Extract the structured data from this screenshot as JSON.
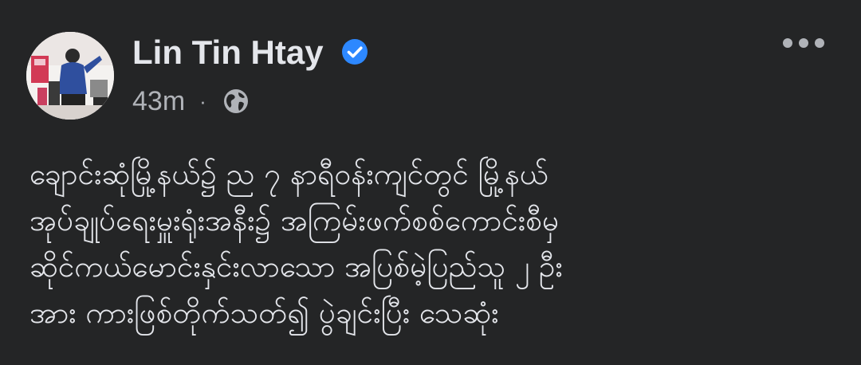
{
  "post": {
    "author": "Lin Tin Htay",
    "verified": true,
    "timestamp": "43m",
    "separator": "·",
    "privacy_icon": "globe-icon",
    "more_icon": "more-horizontal-icon",
    "text_lines": [
      "ချောင်းဆုံမြို့နယ်၌ ည ၇ နာရီဝန်းကျင်တွင် မြို့နယ်",
      "အုပ်ချုပ်ရေးမှူးရုံးအနီး၌ အကြမ်းဖက်စစ်ကောင်းစီမှ",
      "ဆိုင်ကယ်မောင်းနှင်းလာသော အပြစ်မဲ့ပြည်သူ ၂ ဦး",
      "အား ကားဖြစ်တိုက်သတ်၍ ပွဲချင်းပြီး သေဆုံး"
    ]
  },
  "colors": {
    "background": "#242526",
    "primary_text": "#e4e6eb",
    "secondary_text": "#b0b3b8",
    "verified_badge": "#2d88ff"
  }
}
